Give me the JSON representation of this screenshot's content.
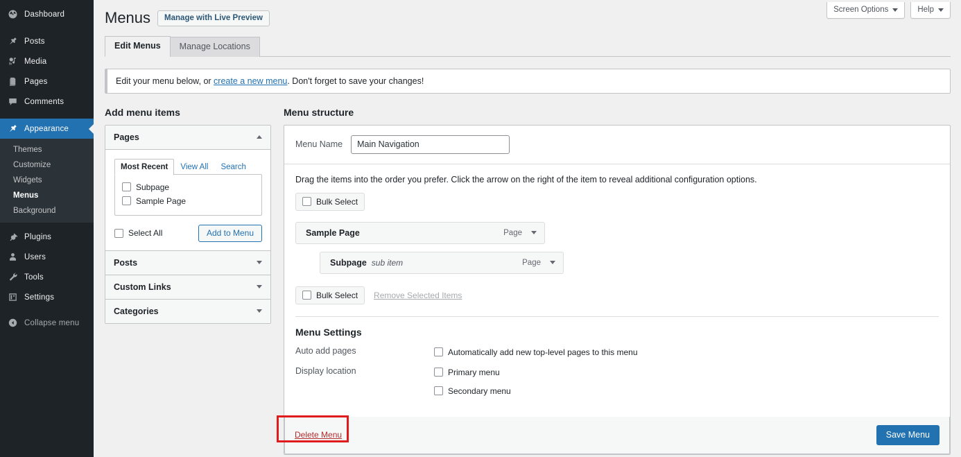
{
  "sidebar": {
    "items": [
      {
        "label": "Dashboard",
        "icon": "dashboard-gauge-icon",
        "current": false,
        "gap_after": true
      },
      {
        "label": "Posts",
        "icon": "pushpin-icon",
        "current": false,
        "gap_after": false
      },
      {
        "label": "Media",
        "icon": "media-camera-icon",
        "current": false,
        "gap_after": false
      },
      {
        "label": "Pages",
        "icon": "page-document-icon",
        "current": false,
        "gap_after": false
      },
      {
        "label": "Comments",
        "icon": "comment-bubble-icon",
        "current": false,
        "gap_after": true
      },
      {
        "label": "Appearance",
        "icon": "appearance-brush-icon",
        "current": true,
        "gap_after": false
      }
    ],
    "submenu": [
      {
        "label": "Themes",
        "current": false
      },
      {
        "label": "Customize",
        "current": false
      },
      {
        "label": "Widgets",
        "current": false
      },
      {
        "label": "Menus",
        "current": true
      },
      {
        "label": "Background",
        "current": false
      }
    ],
    "items_after": [
      {
        "label": "Plugins",
        "icon": "plugin-plug-icon",
        "current": false,
        "gap_after": false
      },
      {
        "label": "Users",
        "icon": "user-person-icon",
        "current": false,
        "gap_after": false
      },
      {
        "label": "Tools",
        "icon": "tools-wrench-icon",
        "current": false,
        "gap_after": false
      },
      {
        "label": "Settings",
        "icon": "settings-sliders-icon",
        "current": false,
        "gap_after": false
      }
    ],
    "collapse": {
      "label": "Collapse menu",
      "icon": "collapse-arrow-circle-icon"
    },
    "colors": {
      "background": "#1d2327",
      "submenu_background": "#2c3338",
      "current_highlight": "#2271b1"
    }
  },
  "meta": {
    "screen_options_label": "Screen Options",
    "help_label": "Help"
  },
  "header": {
    "page_title": "Menus",
    "live_preview_label": "Manage with Live Preview"
  },
  "tabs": [
    {
      "label": "Edit Menus",
      "active": true
    },
    {
      "label": "Manage Locations",
      "active": false
    }
  ],
  "notice": {
    "prefix": "Edit your menu below, or ",
    "link": "create a new menu",
    "suffix": ". Don't forget to save your changes!"
  },
  "add_menu_items": {
    "heading": "Add menu items",
    "sections": [
      {
        "label": "Pages",
        "open": true
      },
      {
        "label": "Posts",
        "open": false
      },
      {
        "label": "Custom Links",
        "open": false
      },
      {
        "label": "Categories",
        "open": false
      }
    ],
    "pages_panel": {
      "tabs": [
        {
          "label": "Most Recent",
          "active": true
        },
        {
          "label": "View All",
          "active": false
        },
        {
          "label": "Search",
          "active": false
        }
      ],
      "items": [
        {
          "label": "Subpage",
          "checked": false
        },
        {
          "label": "Sample Page",
          "checked": false
        }
      ],
      "select_all_label": "Select All",
      "select_all_checked": false,
      "add_button_label": "Add to Menu"
    }
  },
  "menu_structure": {
    "heading": "Menu structure",
    "menu_name_label": "Menu Name",
    "menu_name_value": "Main Navigation",
    "menu_name_placeholder": "Menu Name",
    "drag_hint": "Drag the items into the order you prefer. Click the arrow on the right of the item to reveal additional configuration options.",
    "bulk_select_top_label": "Bulk Select",
    "bulk_select_top_checked": false,
    "bulk_select_bottom_label": "Bulk Select",
    "bulk_select_bottom_checked": false,
    "remove_selected_label": "Remove Selected Items",
    "items": [
      {
        "title": "Sample Page",
        "sub_label": "",
        "type": "Page",
        "depth": 1
      },
      {
        "title": "Subpage",
        "sub_label": "sub item",
        "type": "Page",
        "depth": 2
      }
    ]
  },
  "menu_settings": {
    "heading": "Menu Settings",
    "rows": [
      {
        "label": "Auto add pages",
        "options": [
          {
            "label": "Automatically add new top-level pages to this menu",
            "checked": false
          }
        ]
      },
      {
        "label": "Display location",
        "options": [
          {
            "label": "Primary menu",
            "checked": false
          },
          {
            "label": "Secondary menu",
            "checked": false
          }
        ]
      }
    ]
  },
  "bottom_bar": {
    "delete_label": "Delete Menu",
    "save_label": "Save Menu",
    "delete_color": "#b32d2e",
    "save_color": "#2271b1",
    "highlight_color": "#e01b1b"
  }
}
